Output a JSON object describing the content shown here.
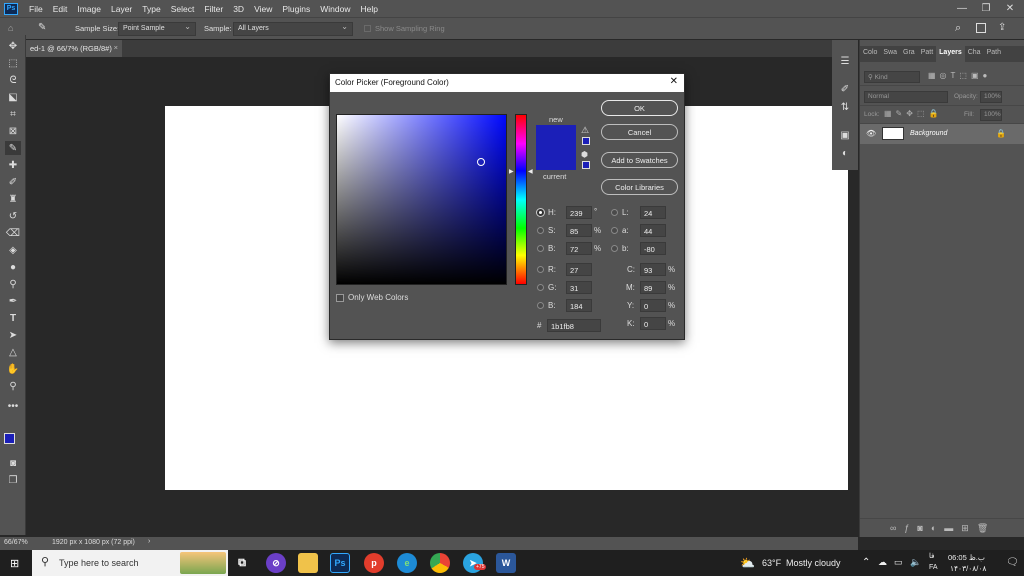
{
  "app": {
    "logo": "Ps",
    "menu": [
      "File",
      "Edit",
      "Image",
      "Layer",
      "Type",
      "Select",
      "Filter",
      "3D",
      "View",
      "Plugins",
      "Window",
      "Help"
    ]
  },
  "options_bar": {
    "sample_size_label": "Sample Size:",
    "sample_size_value": "Point Sample",
    "sample_label": "Sample:",
    "sample_value": "All Layers",
    "show_ring_label": "Show Sampling Ring"
  },
  "document": {
    "tab_title": "ed-1 @ 66/7% (RGB/8#)",
    "tab_close": "×",
    "zoom": "66/67%",
    "doc_info": "1920 px x 1080 px (72 ppi)",
    "status_arrow": "›"
  },
  "panel": {
    "tabs": [
      "Colo",
      "Swa",
      "Gra",
      "Patt",
      "Layers",
      "Cha",
      "Path"
    ],
    "active_tab": "Layers",
    "kind_placeholder": "Kind",
    "blend_mode": "Normal",
    "opacity_label": "Opacity:",
    "opacity_value": "100%",
    "lock_label": "Lock:",
    "fill_label": "Fill:",
    "fill_value": "100%",
    "layer_name": "Background"
  },
  "dialog": {
    "title": "Color Picker (Foreground Color)",
    "close": "✕",
    "new_label": "new",
    "current_label": "current",
    "new_color": "#1b1fb8",
    "current_color": "#1b1fb8",
    "buttons": {
      "ok": "OK",
      "cancel": "Cancel",
      "add_to_swatches": "Add to Swatches",
      "color_libraries": "Color Libraries"
    },
    "only_web_colors": "Only Web Colors",
    "fields": {
      "H": {
        "label": "H:",
        "value": "239",
        "unit": "°"
      },
      "S": {
        "label": "S:",
        "value": "85",
        "unit": "%"
      },
      "B": {
        "label": "B:",
        "value": "72",
        "unit": "%"
      },
      "R": {
        "label": "R:",
        "value": "27"
      },
      "G": {
        "label": "G:",
        "value": "31"
      },
      "Bl": {
        "label": "B:",
        "value": "184"
      },
      "L": {
        "label": "L:",
        "value": "24"
      },
      "a": {
        "label": "a:",
        "value": "44"
      },
      "b": {
        "label": "b:",
        "value": "-80"
      },
      "C": {
        "label": "C:",
        "value": "93",
        "unit": "%"
      },
      "M": {
        "label": "M:",
        "value": "89",
        "unit": "%"
      },
      "Y": {
        "label": "Y:",
        "value": "0",
        "unit": "%"
      },
      "K": {
        "label": "K:",
        "value": "0",
        "unit": "%"
      }
    },
    "hex_label": "#",
    "hex_value": "1b1fb8",
    "hue_base_color": "#0008ff"
  },
  "taskbar": {
    "search_placeholder": "Type here to search",
    "weather_temp": "63°F",
    "weather_text": "Mostly cloudy",
    "language": "FA",
    "time": "06:05 ب.ظ",
    "date": "۱۴۰۳/۰۸/۰۸",
    "lang_top": "فا",
    "telegram_badge": "+75"
  },
  "colors": {
    "foreground": "#1b1fb8",
    "background": "#ffffff",
    "accent": "#31a8ff"
  }
}
